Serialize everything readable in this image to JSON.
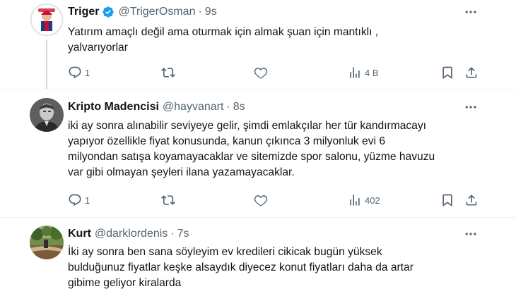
{
  "tweets": [
    {
      "name": "Triger",
      "handle": "@TrigerOsman",
      "dot": "·",
      "time": "9s",
      "lines": [
        "Yatırım amaçlı değil ama oturmak için almak şuan için mantıklı ,",
        "yalvarıyorlar"
      ],
      "replies": "1",
      "views": "4 B"
    },
    {
      "name": "Kripto Madencisi",
      "handle": "@hayvanart",
      "dot": "·",
      "time": "8s",
      "lines": [
        "iki ay sonra alınabilir seviyeye gelir, şimdi emlakçılar her tür kandırmacayı",
        "yapıyor özellikle fiyat konusunda, kanun çıkınca 3 milyonluk evi 6",
        "milyondan satışa koyamayacaklar ve sitemizde spor salonu, yüzme havuzu",
        "var gibi olmayan şeyleri ilana yazamayacaklar."
      ],
      "replies": "1",
      "views": "402"
    },
    {
      "name": "Kurt",
      "handle": "@darklordenis",
      "dot": "·",
      "time": "7s",
      "lines": [
        "İki ay sonra ben sana söyleyim ev kredileri cikicak bugün yüksek",
        "bulduğunuz fiyatlar keşke alsaydık diyecez konut fiyatları daha da artar",
        "gibime geliyor kiralarda"
      ]
    }
  ],
  "colors": {
    "text": "#0f1419",
    "muted": "#536471",
    "verified": "#1d9bf0",
    "divider": "#eff3f4"
  },
  "icons": [
    "verified-badge-icon",
    "more-icon",
    "reply-icon",
    "retweet-icon",
    "like-icon",
    "views-icon",
    "bookmark-icon",
    "share-icon"
  ]
}
